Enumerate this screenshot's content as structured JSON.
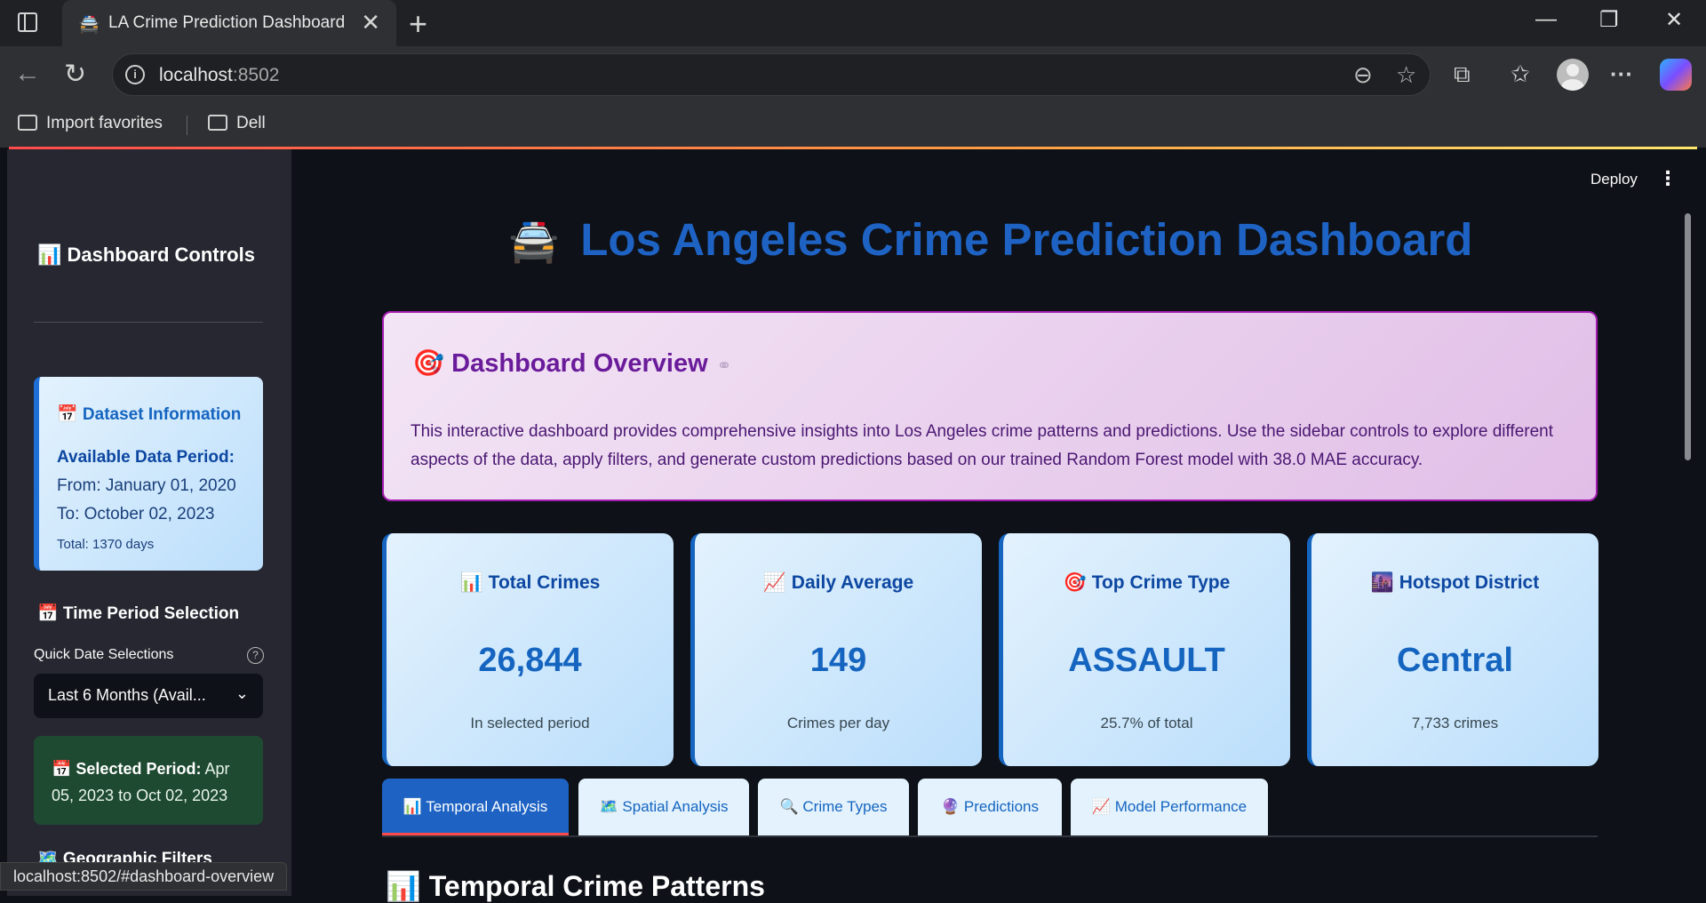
{
  "browser": {
    "tab_title": "LA Crime Prediction Dashboard",
    "tab_favicon": "🚔",
    "url_host": "localhost",
    "url_port": ":8502",
    "bookmarks": [
      "Import favorites",
      "Dell"
    ],
    "status_url": "localhost:8502/#dashboard-overview"
  },
  "app": {
    "deploy_label": "Deploy",
    "title": "Los Angeles Crime Prediction Dashboard",
    "title_emoji": "🚔"
  },
  "sidebar": {
    "title": "📊 Dashboard Controls",
    "dataset": {
      "heading": "📅 Dataset Information",
      "period_label": "Available Data Period:",
      "from": "From: January 01, 2020",
      "to": "To: October 02, 2023",
      "total": "Total: 1370 days"
    },
    "time_section": "📅 Time Period Selection",
    "quick_label": "Quick Date Selections",
    "quick_value": "Last 6 Months (Avail...",
    "selected_label": "📅 Selected Period:",
    "selected_value": " Apr 05, 2023 to Oct 02, 2023",
    "geo_section": "🗺️ Geographic Filters"
  },
  "overview": {
    "heading": "🎯 Dashboard Overview",
    "text": "This interactive dashboard provides comprehensive insights into Los Angeles crime patterns and predictions. Use the sidebar controls to explore different aspects of the data, apply filters, and generate custom predictions based on our trained Random Forest model with 38.0 MAE accuracy."
  },
  "metrics": [
    {
      "title": "📊 Total Crimes",
      "value": "26,844",
      "sub": "In selected period"
    },
    {
      "title": "📈 Daily Average",
      "value": "149",
      "sub": "Crimes per day"
    },
    {
      "title": "🎯 Top Crime Type",
      "value": "ASSAULT",
      "sub": "25.7% of total"
    },
    {
      "title": "🌆 Hotspot District",
      "value": "Central",
      "sub": "7,733 crimes"
    }
  ],
  "tabs": [
    "📊 Temporal Analysis",
    "🗺️ Spatial Analysis",
    "🔍 Crime Types",
    "🔮 Predictions",
    "📈 Model Performance"
  ],
  "section_heading": "📊 Temporal Crime Patterns",
  "colors": {
    "accent_blue": "#1e63c4",
    "overview_border": "#a21caf",
    "period_green": "#1f4a32",
    "active_tab_underline": "#ff4b4b"
  }
}
